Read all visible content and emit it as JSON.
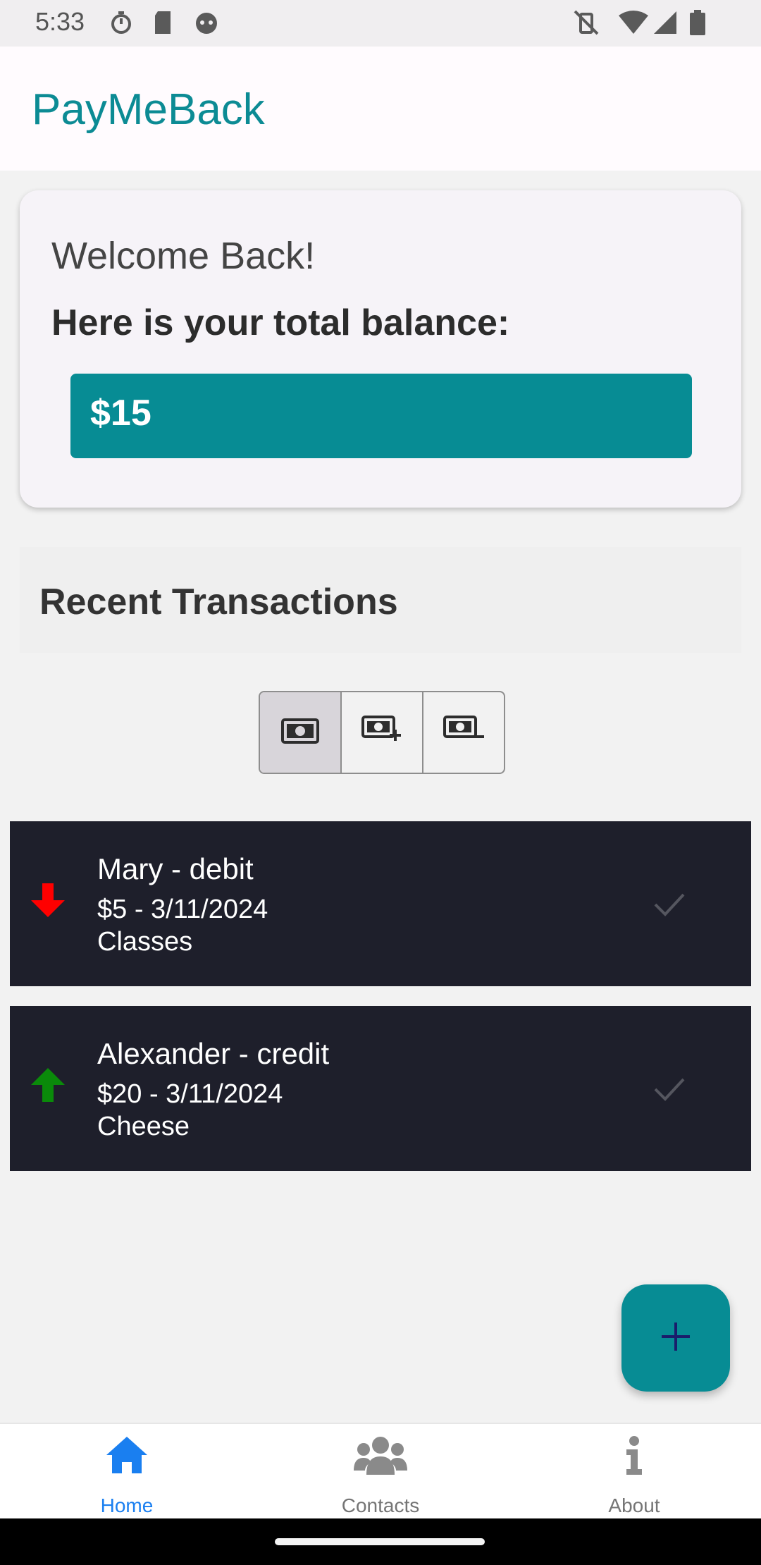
{
  "status_bar": {
    "time": "5:33",
    "left_icons": [
      "stopwatch-icon",
      "sd-card-icon",
      "android-debug-icon"
    ],
    "right_icons": [
      "muted-vibrate-icon",
      "wifi-icon",
      "cell-signal-icon",
      "battery-icon"
    ]
  },
  "app_bar": {
    "title": "PayMeBack"
  },
  "balance_card": {
    "welcome": "Welcome Back!",
    "label": "Here is your total balance:",
    "balance": "$15"
  },
  "transactions_section": {
    "title": "Recent Transactions",
    "filters": [
      {
        "icon": "money-icon",
        "selected": true
      },
      {
        "icon": "money-add-icon",
        "selected": false
      },
      {
        "icon": "money-remove-icon",
        "selected": false
      }
    ]
  },
  "transactions": [
    {
      "title": "Mary - debit",
      "amount_date": "$5 - 3/11/2024",
      "note": "Classes",
      "direction": "down",
      "direction_color": "#ff0000"
    },
    {
      "title": "Alexander - credit",
      "amount_date": "$20 - 3/11/2024",
      "note": "Cheese",
      "direction": "up",
      "direction_color": "#0a8a0a"
    }
  ],
  "fab": {
    "icon": "plus-icon"
  },
  "bottom_nav": {
    "items": [
      {
        "label": "Home",
        "icon": "home-icon",
        "active": true
      },
      {
        "label": "Contacts",
        "icon": "contacts-icon",
        "active": false
      },
      {
        "label": "About",
        "icon": "info-icon",
        "active": false
      }
    ]
  },
  "colors": {
    "accent": "#078c94",
    "title_teal": "#0c8b94",
    "nav_active": "#1a7ff0",
    "card_dark": "#1e1f2b"
  }
}
